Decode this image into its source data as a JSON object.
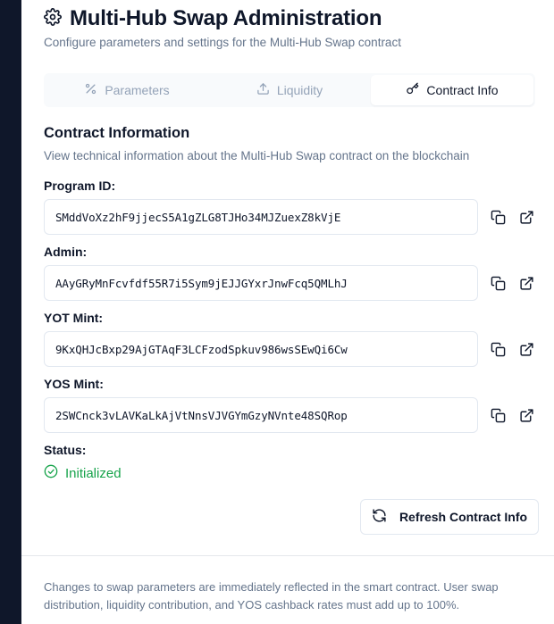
{
  "header": {
    "title": "Multi-Hub Swap Administration",
    "subtitle": "Configure parameters and settings for the Multi-Hub Swap contract",
    "icon": "gear-icon"
  },
  "tabs": [
    {
      "label": "Parameters",
      "icon": "percent-icon",
      "active": false
    },
    {
      "label": "Liquidity",
      "icon": "upload-icon",
      "active": false
    },
    {
      "label": "Contract Info",
      "icon": "key-icon",
      "active": true
    }
  ],
  "contract": {
    "title": "Contract Information",
    "description": "View technical information about the Multi-Hub Swap contract on the blockchain",
    "fields": [
      {
        "label": "Program ID:",
        "value": "SMddVoXz2hF9jjecS5A1gZLG8TJHo34MJZuexZ8kVjE"
      },
      {
        "label": "Admin:",
        "value": "AAyGRyMnFcvfdf55R7i5Sym9jEJJGYxrJnwFcq5QMLhJ"
      },
      {
        "label": "YOT Mint:",
        "value": "9KxQHJcBxp29AjGTAqF3LCFzodSpkuv986wsSEwQi6Cw"
      },
      {
        "label": "YOS Mint:",
        "value": "2SWCnck3vLAVKaLkAjVtNnsVJVGYmGzyNVnte48SQRop"
      }
    ],
    "status_label": "Status:",
    "status_value": "Initialized",
    "refresh_label": "Refresh Contract Info"
  },
  "footer": {
    "note": "Changes to swap parameters are immediately reflected in the smart contract. User swap distribution, liquidity contribution, and YOS cashback rates must add up to 100%."
  },
  "colors": {
    "rail": "#0f172a",
    "text": "#0f172a",
    "muted": "#64748b",
    "border": "#e2e8f0",
    "success": "#16a34a"
  }
}
